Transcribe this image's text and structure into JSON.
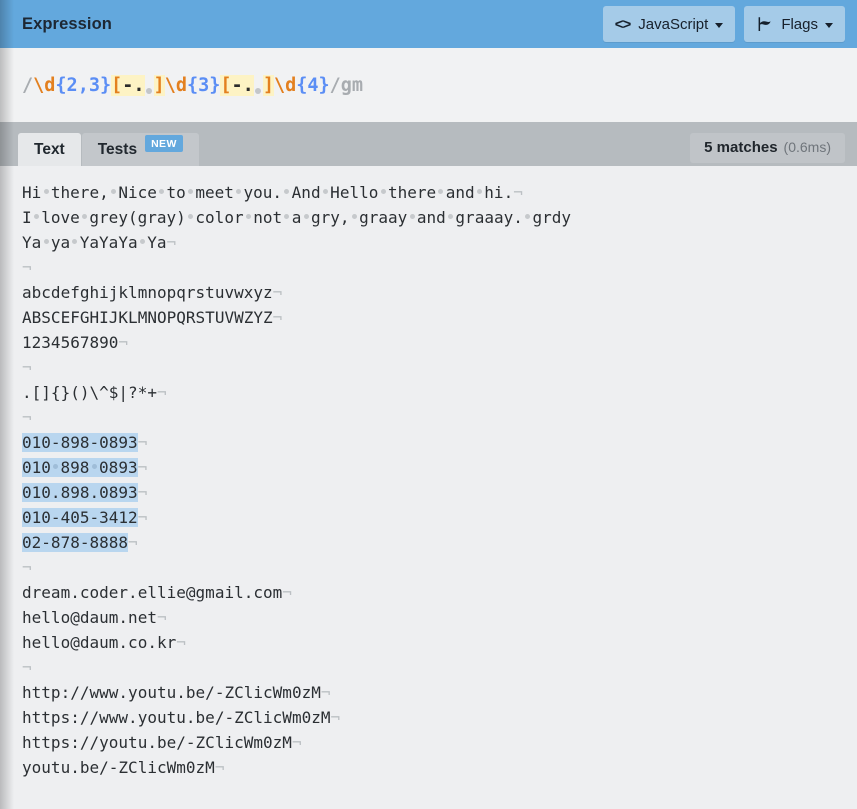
{
  "header": {
    "title": "Expression",
    "buttons": [
      {
        "name": "flavor",
        "label": "JavaScript",
        "icon": "code-icon",
        "icon_glyph": "<>"
      },
      {
        "name": "flags",
        "label": "Flags",
        "icon": "flag-icon",
        "icon_glyph": "⚑"
      }
    ]
  },
  "expression": {
    "delimiter_open": "/",
    "delimiter_close": "/",
    "flags": "gm",
    "full_text": "/\\d{2,3}[-. ]\\d{3}[-. ]\\d{4}/gm",
    "tokens": [
      {
        "type": "delim",
        "text": "/"
      },
      {
        "type": "esc",
        "text": "\\d"
      },
      {
        "type": "quant",
        "text": "{2,3}"
      },
      {
        "type": "set_open",
        "text": "["
      },
      {
        "type": "set_char",
        "text": "-"
      },
      {
        "type": "set_char",
        "text": "."
      },
      {
        "type": "set_space",
        "text": " "
      },
      {
        "type": "set_close",
        "text": "]"
      },
      {
        "type": "esc",
        "text": "\\d"
      },
      {
        "type": "quant",
        "text": "{3}"
      },
      {
        "type": "set_open",
        "text": "["
      },
      {
        "type": "set_char",
        "text": "-"
      },
      {
        "type": "set_char",
        "text": "."
      },
      {
        "type": "set_space",
        "text": " "
      },
      {
        "type": "set_close",
        "text": "]"
      },
      {
        "type": "esc",
        "text": "\\d"
      },
      {
        "type": "quant",
        "text": "{4}"
      },
      {
        "type": "delim",
        "text": "/"
      },
      {
        "type": "flags",
        "text": "gm"
      }
    ]
  },
  "tabs": [
    {
      "name": "text",
      "label": "Text",
      "active": true,
      "badge": null
    },
    {
      "name": "tests",
      "label": "Tests",
      "active": false,
      "badge": "NEW"
    }
  ],
  "matches": {
    "count_label": "5 matches",
    "time_label": "(0.6ms)",
    "count": 5,
    "time_ms": 0.6
  },
  "text_content": {
    "newline_marker": "¬",
    "space_marker": "·",
    "lines": [
      {
        "text": "Hi there, Nice to meet you. And Hello there and hi.",
        "match": false
      },
      {
        "text": "I love grey(gray) color not a gry, graay and graaay. grdy",
        "match": false,
        "no_newline": true
      },
      {
        "text": "Ya ya YaYaYa Ya",
        "match": false
      },
      {
        "text": "",
        "match": false
      },
      {
        "text": "abcdefghijklmnopqrstuvwxyz",
        "match": false
      },
      {
        "text": "ABSCEFGHIJKLMNOPQRSTUVWZYZ",
        "match": false
      },
      {
        "text": "1234567890",
        "match": false
      },
      {
        "text": "",
        "match": false
      },
      {
        "text": ".[]{}()\\^$|?*+",
        "match": false
      },
      {
        "text": "",
        "match": false
      },
      {
        "text": "010-898-0893",
        "match": true
      },
      {
        "text": "010 898 0893",
        "match": true
      },
      {
        "text": "010.898.0893",
        "match": true
      },
      {
        "text": "010-405-3412",
        "match": true
      },
      {
        "text": "02-878-8888",
        "match": true
      },
      {
        "text": "",
        "match": false
      },
      {
        "text": "dream.coder.ellie@gmail.com",
        "match": false
      },
      {
        "text": "hello@daum.net",
        "match": false
      },
      {
        "text": "hello@daum.co.kr",
        "match": false
      },
      {
        "text": "",
        "match": false
      },
      {
        "text": "http://www.youtu.be/-ZClicWm0zM",
        "match": false
      },
      {
        "text": "https://www.youtu.be/-ZClicWm0zM",
        "match": false
      },
      {
        "text": "https://youtu.be/-ZClicWm0zM",
        "match": false
      },
      {
        "text": "youtu.be/-ZClicWm0zM",
        "match": false
      }
    ]
  },
  "colors": {
    "header_blue": "#63a8dd",
    "header_button": "#a5cbe8",
    "tabbar_gray": "#b6bbbf",
    "tab_active": "#e6e8ea",
    "body_bg": "#eeeff1",
    "match_highlight": "#b9d6ef",
    "badge_blue": "#63a8dd",
    "token_escape": "#e3801f",
    "token_quantifier": "#5b8ef5",
    "token_set_bg": "#fdf3c4",
    "token_delimiter": "#a8acb0"
  }
}
